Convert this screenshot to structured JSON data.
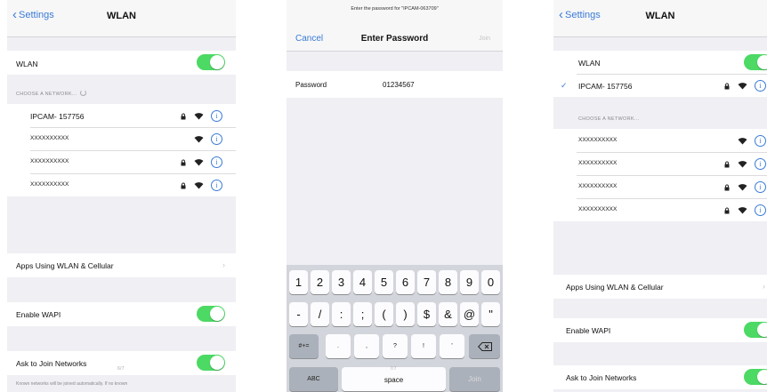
{
  "colors": {
    "accent": "#3a7bd5",
    "toggle_on": "#4cd964",
    "background": "#efeff4"
  },
  "screens": [
    {
      "back_label": "Settings",
      "title": "WLAN",
      "wlan_label": "WLAN",
      "section_header": "CHOOSE A NETWORK...",
      "networks": [
        {
          "name": "IPCAM- 157756",
          "locked": true
        },
        {
          "name": "XXXXXXXXXX",
          "locked": false
        },
        {
          "name": "XXXXXXXXXX",
          "locked": true
        },
        {
          "name": "XXXXXXXXXX",
          "locked": true
        }
      ],
      "apps_label": "Apps Using WLAN & Cellular",
      "wapi_label": "Enable WAPI",
      "ask_label": "Ask to Join Networks",
      "footnote": "Known networks will be joined automatically. If no known",
      "page_num": "6/7"
    },
    {
      "prompt": "Enter the password for \"IPCAM-063709\"",
      "cancel_label": "Cancel",
      "title": "Enter Password",
      "join_label": "Join",
      "password_label": "Password",
      "password_value": "01234567",
      "keyboard": {
        "row1": [
          "1",
          "2",
          "3",
          "4",
          "5",
          "6",
          "7",
          "8",
          "9",
          "0"
        ],
        "row2": [
          "-",
          "/",
          ":",
          ";",
          "(",
          ")",
          "$",
          "&",
          "@",
          "\""
        ],
        "row3_left": "#+=",
        "row3": [
          ".",
          ",",
          "?",
          "!",
          "'"
        ],
        "abc_label": "ABC",
        "space_label": "space",
        "join_label": "Join",
        "page_num": "7/7"
      }
    },
    {
      "back_label": "Settings",
      "title": "WLAN",
      "wlan_label": "WLAN",
      "connected_network": "IPCAM- 157756",
      "section_header": "CHOOSE A NETWORK...",
      "networks": [
        {
          "name": "XXXXXXXXXX",
          "locked": false
        },
        {
          "name": "XXXXXXXXXX",
          "locked": true
        },
        {
          "name": "XXXXXXXXXX",
          "locked": true
        },
        {
          "name": "XXXXXXXXXX",
          "locked": true
        }
      ],
      "apps_label": "Apps Using WLAN & Cellular",
      "wapi_label": "Enable WAPI",
      "ask_label": "Ask to Join Networks"
    }
  ]
}
